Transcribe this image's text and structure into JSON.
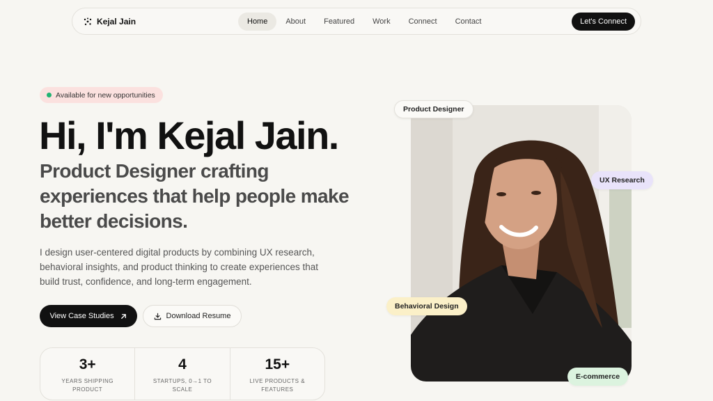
{
  "nav": {
    "brand": "Kejal Jain",
    "links": [
      "Home",
      "About",
      "Featured",
      "Work",
      "Connect",
      "Contact"
    ],
    "active": "Home",
    "cta": "Let's Connect"
  },
  "hero": {
    "badge": "Available for new opportunities",
    "title": "Hi, I'm Kejal Jain.",
    "subtitle": "Product Designer crafting experiences that help people make better decisions.",
    "description": "I design user-centered digital products by combining UX research, behavioral insights, and product thinking to create experiences that build trust, confidence, and long-term engagement.",
    "primary_button": "View Case Studies",
    "secondary_button": "Download Resume"
  },
  "stats": [
    {
      "number": "3+",
      "label": "Years shipping product"
    },
    {
      "number": "4",
      "label": "Startups, 0→1 to scale"
    },
    {
      "number": "15+",
      "label": "Live products & features"
    }
  ],
  "tags": {
    "product_designer": "Product Designer",
    "ux_research": "UX Research",
    "behavioral_design": "Behavioral Design",
    "ecommerce": "E-commerce"
  },
  "colors": {
    "background": "#f7f6f2",
    "primary": "#111111",
    "badge_bg": "#fbe1df",
    "status_dot": "#22b373",
    "tag_ux": "#e9e3fa",
    "tag_behavioral": "#fbf0c8",
    "tag_ecommerce": "#dcf3df"
  },
  "icons": {
    "brand": "sparkle-icon",
    "primary_button": "arrow-up-right-icon",
    "secondary_button": "download-icon"
  }
}
